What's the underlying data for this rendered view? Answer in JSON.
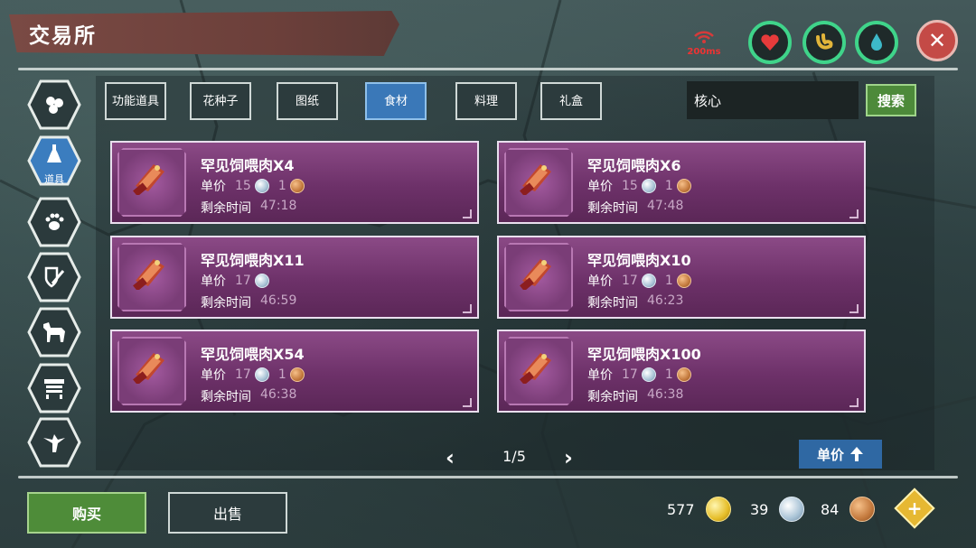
{
  "header": {
    "title": "交易所",
    "ping": "200ms"
  },
  "hud": {
    "stats": [
      {
        "icon": "heart-icon",
        "color": "#e63b3b"
      },
      {
        "icon": "stomach-icon",
        "color": "#e2b53a"
      },
      {
        "icon": "water-drop-icon",
        "color": "#3db9c9"
      }
    ]
  },
  "sidebar": {
    "items": [
      {
        "icon": "seeds-icon",
        "label": ""
      },
      {
        "icon": "tool-icon",
        "label": "道具"
      },
      {
        "icon": "paw-icon",
        "label": ""
      },
      {
        "icon": "shield-sword-icon",
        "label": ""
      },
      {
        "icon": "horse-icon",
        "label": ""
      },
      {
        "icon": "furniture-icon",
        "label": ""
      },
      {
        "icon": "bird-icon",
        "label": ""
      }
    ]
  },
  "tabs": [
    {
      "label": "功能道具"
    },
    {
      "label": "花种子"
    },
    {
      "label": "图纸"
    },
    {
      "label": "食材"
    },
    {
      "label": "料理"
    },
    {
      "label": "礼盒"
    }
  ],
  "search": {
    "value": "核心",
    "button": "搜索"
  },
  "listings": [
    {
      "name": "罕见饲喂肉X4",
      "price_label": "单价",
      "silver": "15",
      "bronze": "1",
      "time_label": "剩余时间",
      "time": "47:18"
    },
    {
      "name": "罕见饲喂肉X6",
      "price_label": "单价",
      "silver": "15",
      "bronze": "1",
      "time_label": "剩余时间",
      "time": "47:48"
    },
    {
      "name": "罕见饲喂肉X11",
      "price_label": "单价",
      "silver": "17",
      "bronze": "",
      "time_label": "剩余时间",
      "time": "46:59"
    },
    {
      "name": "罕见饲喂肉X10",
      "price_label": "单价",
      "silver": "17",
      "bronze": "1",
      "time_label": "剩余时间",
      "time": "46:23"
    },
    {
      "name": "罕见饲喂肉X54",
      "price_label": "单价",
      "silver": "17",
      "bronze": "1",
      "time_label": "剩余时间",
      "time": "46:38"
    },
    {
      "name": "罕见饲喂肉X100",
      "price_label": "单价",
      "silver": "17",
      "bronze": "1",
      "time_label": "剩余时间",
      "time": "46:38"
    }
  ],
  "pager": {
    "prev": "‹",
    "page": "1/5",
    "next": "›"
  },
  "sort": {
    "label": "单价"
  },
  "footer": {
    "buy": "购买",
    "sell": "出售",
    "gold": "577",
    "silver": "39",
    "bronze": "84",
    "add": "+"
  },
  "colors": {
    "accent_tab": "#3a78b8",
    "buy_green": "#4e8c39",
    "card_purple": "#6d3169"
  }
}
